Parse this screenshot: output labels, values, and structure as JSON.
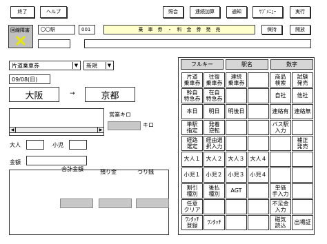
{
  "toolbar": {
    "end_label": "終了",
    "help_label": "ヘルプ",
    "inquiry_label": "照会",
    "continuous_add_label": "連続加算",
    "notice_label": "通知",
    "submenu_label": "ｻﾌﾞﾒﾆｭｰ",
    "execute_label": "実行"
  },
  "status": {
    "line_failure_label": "回線障害",
    "station_label": "〇〇駅",
    "terminal_no": "001",
    "mode_banner": "乗　車　券　・　料　金　券　発　売",
    "hold_label": "保持",
    "open_close_label": "開放"
  },
  "form": {
    "ticket_type": "片道乗車券",
    "issue_type": "新規",
    "date": "09/08(日)",
    "from_station": "大阪",
    "arrow": "→",
    "to_station": "京都",
    "business_km_label": "営業キロ",
    "km_unit": "キロ",
    "adult_label": "大人",
    "child_label": "小児",
    "amount_label": "金額",
    "total_amount_label": "合計金額",
    "deposit_label": "預り金",
    "change_label": "つり銭"
  },
  "keypad": {
    "headers": [
      "フルキー",
      "駅名",
      "数字"
    ],
    "rows": [
      [
        "片道\n乗車券",
        "往復\n乗車券",
        "連続\n乗車券",
        "",
        "商品\n検索",
        "試験\n発売"
      ],
      [
        "幹自\n特急券",
        "在自\n特急券",
        "",
        "",
        "自社",
        "他社"
      ],
      [
        "本日",
        "明日",
        "明後日",
        "",
        "連絡有",
        "連絡無"
      ],
      [
        "単駅\n指定",
        "発着\n逆転",
        "",
        "",
        "バス駅\n入力",
        ""
      ],
      [
        "経路\n選定",
        "経由選\n択入力",
        "",
        "",
        "",
        "補正\n発売"
      ],
      [
        "大人１",
        "大人２",
        "大人３",
        "大人４",
        "",
        ""
      ],
      [
        "小児１",
        "小児２",
        "小児３",
        "小児４",
        "",
        ""
      ],
      [
        "割引\n種別",
        "後払\n種別",
        "AGT",
        "",
        "単価\n手入力",
        ""
      ],
      [
        "任意\nクリア",
        "",
        "",
        "",
        "不足金\n入力",
        ""
      ],
      [
        "ﾜﾝﾀｯﾁ\n登録",
        "ﾜﾝﾀｯﾁ",
        "",
        "",
        "磁気\n読込",
        "出場証"
      ]
    ]
  },
  "colors": {
    "banner_bg": "#ffffcc",
    "gray_field": "#c8c8c8",
    "header_gray": "#d6d6d6",
    "failure_bg": "#c0c0c0",
    "failure_mark": "#e8e800"
  },
  "icons": {
    "failure_mark": "x-mark-icon",
    "dropdown": "chevron-down-icon",
    "scroll_left": "arrow-left-icon",
    "scroll_right": "arrow-right-icon"
  }
}
